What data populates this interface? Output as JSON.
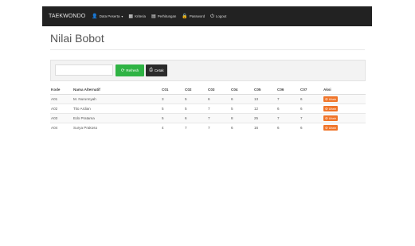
{
  "navbar": {
    "brand": "TAEKWONDO",
    "items": [
      {
        "icon": "user-icon",
        "glyph": "👤",
        "label": "Data Peserta",
        "has_dropdown": true
      },
      {
        "icon": "grid-icon",
        "glyph": "▦",
        "label": "Kriteria"
      },
      {
        "icon": "calculator-icon",
        "glyph": "▤",
        "label": "Perhitungan"
      },
      {
        "icon": "lock-icon",
        "glyph": "🔒",
        "label": "Password"
      },
      {
        "icon": "logout-icon",
        "glyph": "⏻",
        "label": "Logout"
      }
    ]
  },
  "page": {
    "title": "Nilai Bobot"
  },
  "toolbar": {
    "search_placeholder": "",
    "refresh_label": "Refresh",
    "refresh_icon": "refresh-icon",
    "print_label": "Cetak",
    "print_icon": "print-icon"
  },
  "table": {
    "headers": [
      "Kode",
      "Nama Alternatif",
      "C01",
      "C02",
      "C03",
      "C04",
      "C05",
      "C06",
      "C07",
      "Aksi"
    ],
    "rows": [
      {
        "kode": "A01",
        "nama": "M. Nurunnyah",
        "c01": "3",
        "c02": "5",
        "c03": "6",
        "c04": "6",
        "c05": "13",
        "c06": "7",
        "c07": "6"
      },
      {
        "kode": "A02",
        "nama": "Tito Ardian",
        "c01": "5",
        "c02": "5",
        "c03": "7",
        "c04": "5",
        "c05": "12",
        "c06": "6",
        "c07": "6"
      },
      {
        "kode": "A03",
        "nama": "Edo Pratama",
        "c01": "5",
        "c02": "6",
        "c03": "7",
        "c04": "8",
        "c05": "25",
        "c06": "7",
        "c07": "7"
      },
      {
        "kode": "A04",
        "nama": "Surya Prakoso",
        "c01": "4",
        "c02": "7",
        "c03": "7",
        "c04": "6",
        "c05": "16",
        "c06": "6",
        "c07": "6"
      }
    ],
    "action_label": "Ubah",
    "action_icon": "edit-icon"
  },
  "colors": {
    "navbar_bg": "#222222",
    "refresh_btn": "#2fb344",
    "print_btn": "#2b2b2b",
    "action_btn": "#f0752a"
  }
}
